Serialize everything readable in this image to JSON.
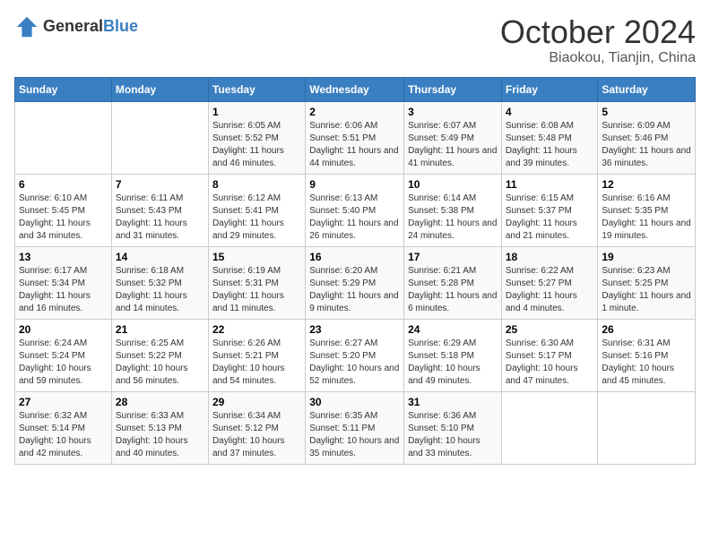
{
  "logo": {
    "general": "General",
    "blue": "Blue"
  },
  "header": {
    "month": "October 2024",
    "location": "Biaokou, Tianjin, China"
  },
  "days_of_week": [
    "Sunday",
    "Monday",
    "Tuesday",
    "Wednesday",
    "Thursday",
    "Friday",
    "Saturday"
  ],
  "weeks": [
    [
      {
        "day": null
      },
      {
        "day": null
      },
      {
        "day": "1",
        "sunrise": "6:05 AM",
        "sunset": "5:52 PM",
        "daylight": "11 hours and 46 minutes."
      },
      {
        "day": "2",
        "sunrise": "6:06 AM",
        "sunset": "5:51 PM",
        "daylight": "11 hours and 44 minutes."
      },
      {
        "day": "3",
        "sunrise": "6:07 AM",
        "sunset": "5:49 PM",
        "daylight": "11 hours and 41 minutes."
      },
      {
        "day": "4",
        "sunrise": "6:08 AM",
        "sunset": "5:48 PM",
        "daylight": "11 hours and 39 minutes."
      },
      {
        "day": "5",
        "sunrise": "6:09 AM",
        "sunset": "5:46 PM",
        "daylight": "11 hours and 36 minutes."
      }
    ],
    [
      {
        "day": "6",
        "sunrise": "6:10 AM",
        "sunset": "5:45 PM",
        "daylight": "11 hours and 34 minutes."
      },
      {
        "day": "7",
        "sunrise": "6:11 AM",
        "sunset": "5:43 PM",
        "daylight": "11 hours and 31 minutes."
      },
      {
        "day": "8",
        "sunrise": "6:12 AM",
        "sunset": "5:41 PM",
        "daylight": "11 hours and 29 minutes."
      },
      {
        "day": "9",
        "sunrise": "6:13 AM",
        "sunset": "5:40 PM",
        "daylight": "11 hours and 26 minutes."
      },
      {
        "day": "10",
        "sunrise": "6:14 AM",
        "sunset": "5:38 PM",
        "daylight": "11 hours and 24 minutes."
      },
      {
        "day": "11",
        "sunrise": "6:15 AM",
        "sunset": "5:37 PM",
        "daylight": "11 hours and 21 minutes."
      },
      {
        "day": "12",
        "sunrise": "6:16 AM",
        "sunset": "5:35 PM",
        "daylight": "11 hours and 19 minutes."
      }
    ],
    [
      {
        "day": "13",
        "sunrise": "6:17 AM",
        "sunset": "5:34 PM",
        "daylight": "11 hours and 16 minutes."
      },
      {
        "day": "14",
        "sunrise": "6:18 AM",
        "sunset": "5:32 PM",
        "daylight": "11 hours and 14 minutes."
      },
      {
        "day": "15",
        "sunrise": "6:19 AM",
        "sunset": "5:31 PM",
        "daylight": "11 hours and 11 minutes."
      },
      {
        "day": "16",
        "sunrise": "6:20 AM",
        "sunset": "5:29 PM",
        "daylight": "11 hours and 9 minutes."
      },
      {
        "day": "17",
        "sunrise": "6:21 AM",
        "sunset": "5:28 PM",
        "daylight": "11 hours and 6 minutes."
      },
      {
        "day": "18",
        "sunrise": "6:22 AM",
        "sunset": "5:27 PM",
        "daylight": "11 hours and 4 minutes."
      },
      {
        "day": "19",
        "sunrise": "6:23 AM",
        "sunset": "5:25 PM",
        "daylight": "11 hours and 1 minute."
      }
    ],
    [
      {
        "day": "20",
        "sunrise": "6:24 AM",
        "sunset": "5:24 PM",
        "daylight": "10 hours and 59 minutes."
      },
      {
        "day": "21",
        "sunrise": "6:25 AM",
        "sunset": "5:22 PM",
        "daylight": "10 hours and 56 minutes."
      },
      {
        "day": "22",
        "sunrise": "6:26 AM",
        "sunset": "5:21 PM",
        "daylight": "10 hours and 54 minutes."
      },
      {
        "day": "23",
        "sunrise": "6:27 AM",
        "sunset": "5:20 PM",
        "daylight": "10 hours and 52 minutes."
      },
      {
        "day": "24",
        "sunrise": "6:29 AM",
        "sunset": "5:18 PM",
        "daylight": "10 hours and 49 minutes."
      },
      {
        "day": "25",
        "sunrise": "6:30 AM",
        "sunset": "5:17 PM",
        "daylight": "10 hours and 47 minutes."
      },
      {
        "day": "26",
        "sunrise": "6:31 AM",
        "sunset": "5:16 PM",
        "daylight": "10 hours and 45 minutes."
      }
    ],
    [
      {
        "day": "27",
        "sunrise": "6:32 AM",
        "sunset": "5:14 PM",
        "daylight": "10 hours and 42 minutes."
      },
      {
        "day": "28",
        "sunrise": "6:33 AM",
        "sunset": "5:13 PM",
        "daylight": "10 hours and 40 minutes."
      },
      {
        "day": "29",
        "sunrise": "6:34 AM",
        "sunset": "5:12 PM",
        "daylight": "10 hours and 37 minutes."
      },
      {
        "day": "30",
        "sunrise": "6:35 AM",
        "sunset": "5:11 PM",
        "daylight": "10 hours and 35 minutes."
      },
      {
        "day": "31",
        "sunrise": "6:36 AM",
        "sunset": "5:10 PM",
        "daylight": "10 hours and 33 minutes."
      },
      {
        "day": null
      },
      {
        "day": null
      }
    ]
  ],
  "labels": {
    "sunrise": "Sunrise:",
    "sunset": "Sunset:",
    "daylight": "Daylight:"
  }
}
